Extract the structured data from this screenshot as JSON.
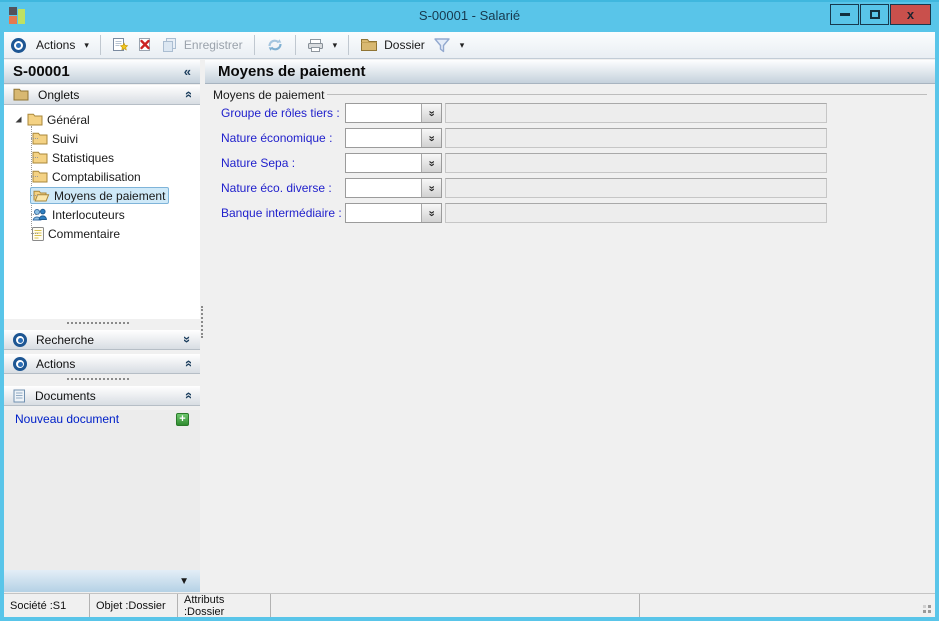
{
  "window": {
    "title": "S-00001 -  Salarié"
  },
  "glyphs": {
    "dropdown": "▾",
    "collapse_left": "«",
    "double_chevron": "»",
    "close": "x",
    "plus": "+",
    "scroll_down": "▼"
  },
  "toolbar": {
    "actions_label": "Actions",
    "save_label": "Enregistrer",
    "dossier_label": "Dossier"
  },
  "sidebar": {
    "title": "S-00001",
    "panels": {
      "onglets": "Onglets",
      "recherche": "Recherche",
      "actions": "Actions",
      "documents": "Documents"
    },
    "tree_root": "Général",
    "tree_items": [
      {
        "icon": "folder-closed-icon",
        "label": "Suivi"
      },
      {
        "icon": "folder-closed-icon",
        "label": "Statistiques"
      },
      {
        "icon": "folder-closed-icon",
        "label": "Comptabilisation"
      },
      {
        "icon": "folder-open-icon",
        "label": "Moyens de paiement",
        "selected": true
      },
      {
        "icon": "people-icon",
        "label": "Interlocuteurs"
      },
      {
        "icon": "note-icon",
        "label": "Commentaire"
      }
    ],
    "new_document_label": "Nouveau document"
  },
  "main": {
    "title": "Moyens de paiement",
    "group_label": "Moyens de paiement",
    "fields": [
      {
        "label": "Groupe de rôles tiers :",
        "value": "",
        "display": ""
      },
      {
        "label": "Nature économique :",
        "value": "",
        "display": ""
      },
      {
        "label": "Nature Sepa :",
        "value": "",
        "display": ""
      },
      {
        "label": "Nature éco. diverse :",
        "value": "",
        "display": ""
      },
      {
        "label": "Banque intermédiaire :",
        "value": "",
        "display": ""
      }
    ]
  },
  "statusbar": {
    "societe": "Société :S1",
    "objet": "Objet :Dossier",
    "attributs": "Attributs :Dossier"
  },
  "colors": {
    "titlebar_blue": "#59c5e9",
    "close_red": "#c9504c",
    "selection_blue": "#cfe9f8",
    "label_blue": "#2121cc",
    "link_blue": "#0020c8"
  }
}
